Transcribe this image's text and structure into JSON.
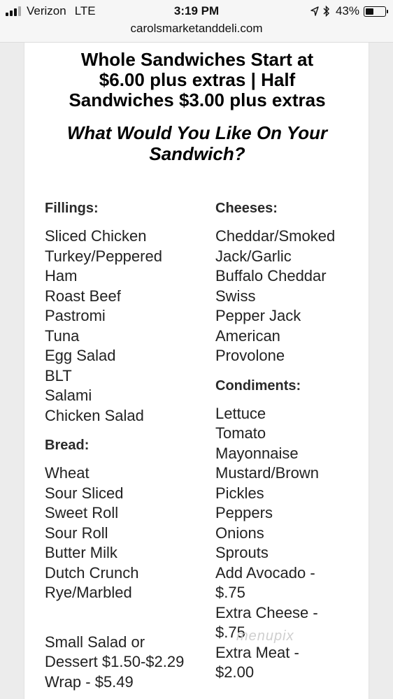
{
  "status_bar": {
    "carrier": "Verizon",
    "network": "LTE",
    "time": "3:19 PM",
    "battery_percent": "43%",
    "battery_level": 0.43
  },
  "browser": {
    "url": "carolsmarketanddeli.com"
  },
  "menu": {
    "headline": [
      "Whole Sandwiches Start at",
      "$6.00 plus extras | Half",
      "Sandwiches $3.00 plus extras"
    ],
    "subhead": [
      "What Would You Like On Your",
      "Sandwich?"
    ],
    "fillings": {
      "title": "Fillings:",
      "items": [
        "Sliced Chicken",
        "Turkey/Peppered",
        "Ham",
        "Roast Beef",
        "Pastromi",
        "Tuna",
        "Egg Salad",
        "BLT",
        "Salami",
        "Chicken Salad"
      ]
    },
    "bread": {
      "title": "Bread:",
      "items": [
        "Wheat",
        "Sour Sliced",
        "Sweet Roll",
        "Sour Roll",
        "Butter Milk",
        "Dutch Crunch",
        "Rye/Marbled"
      ]
    },
    "extras_left": [
      "Small Salad or",
      "Dessert $1.50-$2.29",
      "Wrap - $5.49"
    ],
    "cheeses": {
      "title": "Cheeses:",
      "items": [
        "Cheddar/Smoked",
        "Jack/Garlic",
        "Buffalo Cheddar",
        "Swiss",
        "Pepper Jack",
        "American",
        "Provolone"
      ]
    },
    "condiments": {
      "title": "Condiments:",
      "items": [
        "Lettuce",
        "Tomato",
        "Mayonnaise",
        "Mustard/Brown",
        "Pickles",
        "Peppers",
        "Onions",
        "Sprouts",
        "Add Avocado -",
        "$.75",
        "Extra Cheese -",
        "$.75",
        "Extra Meat -",
        "$2.00"
      ]
    }
  },
  "watermark": "menupix"
}
